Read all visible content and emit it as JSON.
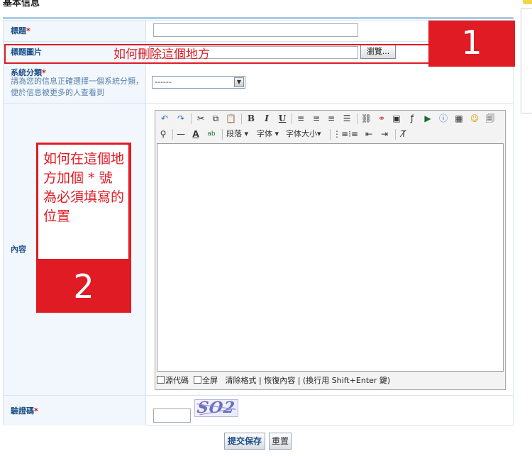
{
  "page": {
    "section_title": "基本信息"
  },
  "form": {
    "title_label": "標題",
    "image_label": "標題圖片",
    "browse_label": "瀏覽...",
    "category_label": "系統分類",
    "category_hint": "請為您的信息正確選擇一個系統分類，便於信息被更多的人查看到",
    "category_selected": "------",
    "content_label": "內容",
    "captcha_label": "驗證碼",
    "captcha_text": "SO2",
    "required_mark": "*",
    "submit_label": "提交保存",
    "reset_label": "重置"
  },
  "editor": {
    "toolbar1": [
      "undo-icon",
      "redo-icon",
      "cut-icon",
      "copy-icon",
      "paste-icon",
      "bold-icon",
      "italic-icon",
      "underline-icon",
      "align-left-icon",
      "align-center-icon",
      "align-right-icon",
      "align-justify-icon",
      "link-icon",
      "unlink-icon",
      "image-icon",
      "flash-icon",
      "media-icon",
      "info-icon",
      "table-icon",
      "smiley-icon",
      "template-icon"
    ],
    "paragraph_label": "段落",
    "font_label": "字体",
    "font_size_label": "字体大小",
    "status": {
      "source_label": "源代碼",
      "fullscreen_label": "全屏",
      "clear_format_label": "清除格式",
      "restore_label": "恢復內容",
      "newline_hint": "(換行用 Shift+Enter 鍵)"
    }
  },
  "annotations": {
    "note1_text": "如何刪除這個地方",
    "note1_number": "1",
    "note2_text": "如何在這個地方加個 * 號為必須填寫的位置",
    "note2_number": "2"
  },
  "colors": {
    "label_blue": "#1d4f88",
    "required_red": "#d00000",
    "annotation_red": "#e01b24",
    "label_bg": "#f1f7fc"
  }
}
